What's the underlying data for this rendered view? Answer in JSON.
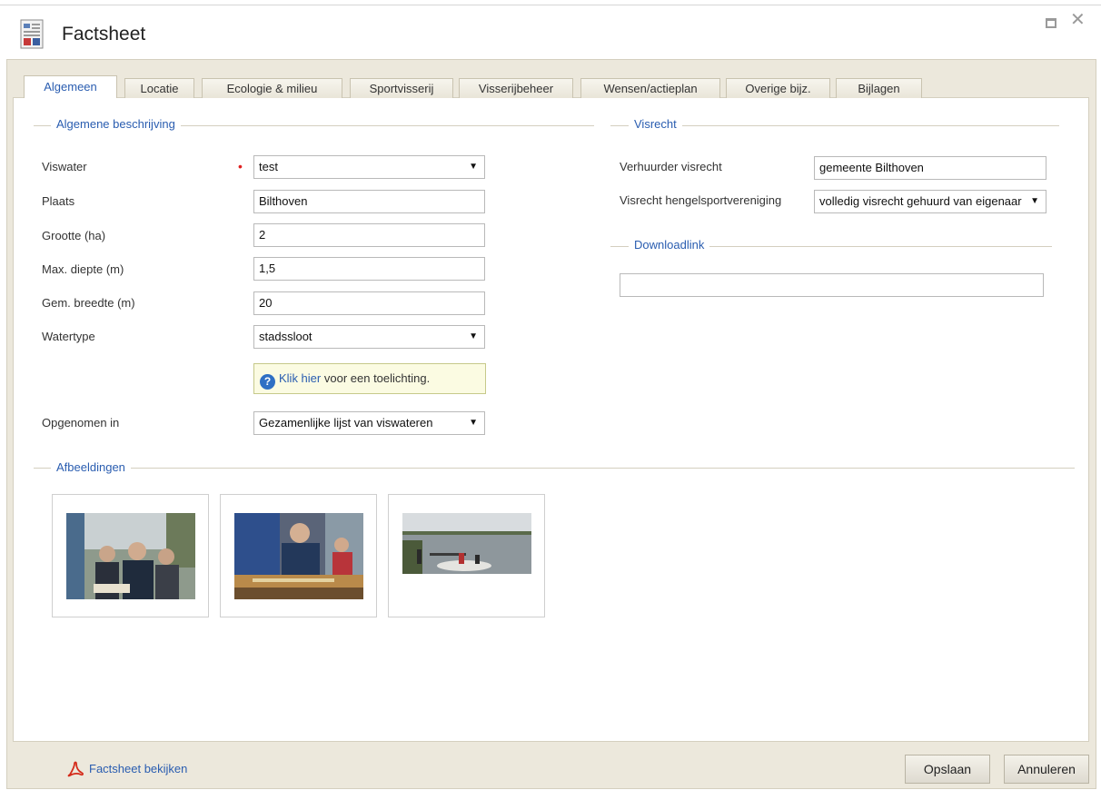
{
  "window": {
    "title": "Factsheet",
    "title_icon": "document-icon",
    "maximize_icon": "maximize-icon",
    "close_icon": "close-icon",
    "close_glyph": "✕"
  },
  "tabs": [
    {
      "label": "Algemeen",
      "active": true
    },
    {
      "label": "Locatie"
    },
    {
      "label": "Ecologie & milieu"
    },
    {
      "label": "Sportvisserij"
    },
    {
      "label": "Visserijbeheer"
    },
    {
      "label": "Wensen/actieplan"
    },
    {
      "label": "Overige bijz."
    },
    {
      "label": "Bijlagen"
    }
  ],
  "algemeen": {
    "legend": "Algemene beschrijving",
    "fields": {
      "viswater": {
        "label": "Viswater",
        "value": "test",
        "required_marker": "•"
      },
      "plaats": {
        "label": "Plaats",
        "value": "Bilthoven"
      },
      "grootte": {
        "label": "Grootte (ha)",
        "value": "2"
      },
      "diepte": {
        "label": "Max. diepte (m)",
        "value": "1,5"
      },
      "breedte": {
        "label": "Gem. breedte (m)",
        "value": "20"
      },
      "watertype": {
        "label": "Watertype",
        "value": "stadssloot"
      },
      "opgenomen": {
        "label": "Opgenomen in",
        "value": "Gezamenlijke lijst van viswateren"
      }
    },
    "hint": {
      "icon": "help-icon",
      "icon_glyph": "?",
      "link": "Klik hier",
      "text": " voor een toelichting."
    }
  },
  "visrecht": {
    "legend": "Visrecht",
    "verhuurder": {
      "label": "Verhuurder visrecht",
      "value": "gemeente Bilthoven"
    },
    "hsv": {
      "label": "Visrecht hengelsportvereniging",
      "value": "volledig visrecht gehuurd van eigenaar"
    }
  },
  "download": {
    "legend": "Downloadlink",
    "value": ""
  },
  "afbeeldingen": {
    "legend": "Afbeeldingen",
    "images": [
      "photo-group-outdoors",
      "photo-fish-measuring",
      "photo-boat-on-lake"
    ]
  },
  "select_arrow": "▼",
  "footer": {
    "pdf_icon": "pdf-icon",
    "view_link": "Factsheet bekijken",
    "save_button": "Opslaan",
    "cancel_button": "Annuleren"
  }
}
